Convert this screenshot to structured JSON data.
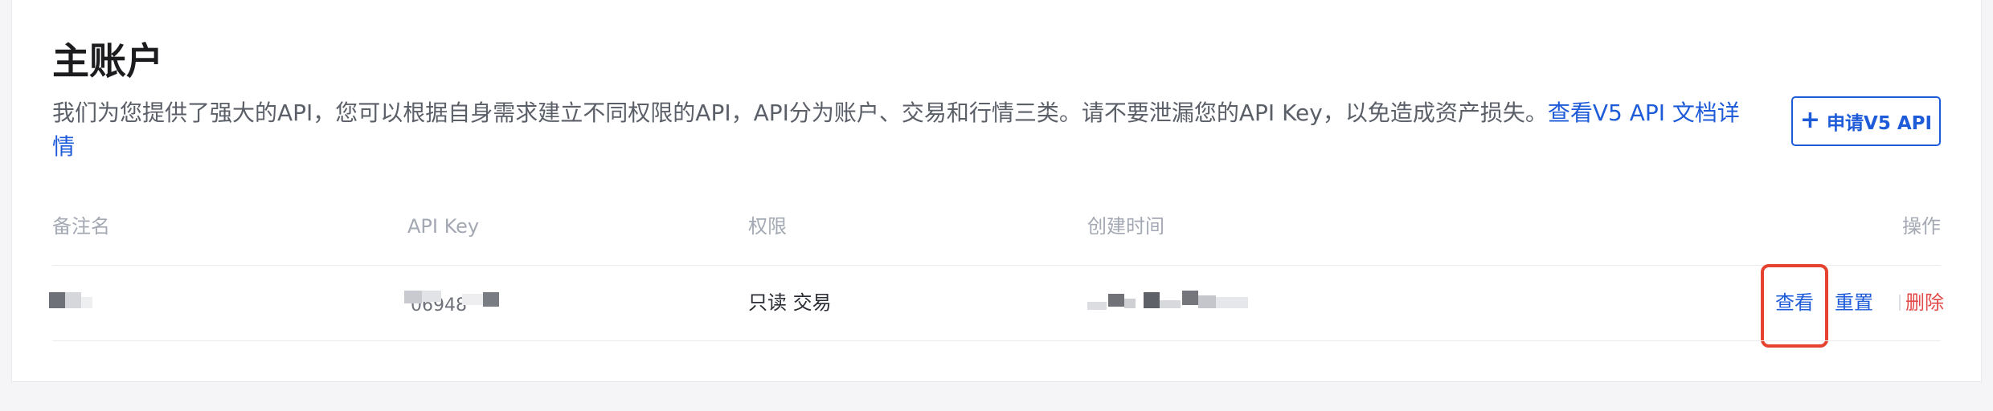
{
  "account": {
    "title": "主账户",
    "description": "我们为您提供了强大的API，您可以根据自身需求建立不同权限的API，API分为账户、交易和行情三类。请不要泄漏您的API Key，以免造成资产损失。",
    "docs_link": "查看V5 API 文档详情",
    "apply_button": "申请V5 API",
    "apply_icon": "+"
  },
  "table": {
    "headers": {
      "remark": "备注名",
      "api_key": "API Key",
      "permission": "权限",
      "created": "创建时间",
      "actions": "操作"
    },
    "rows": [
      {
        "remark": "",
        "api_key": "06948",
        "permission": "只读 交易",
        "created": "",
        "view": "查看",
        "reset": "重置",
        "delete": "删除"
      }
    ]
  },
  "colors": {
    "accent": "#1e5bd8",
    "danger": "#e24a4a",
    "highlight": "#e5432f"
  }
}
